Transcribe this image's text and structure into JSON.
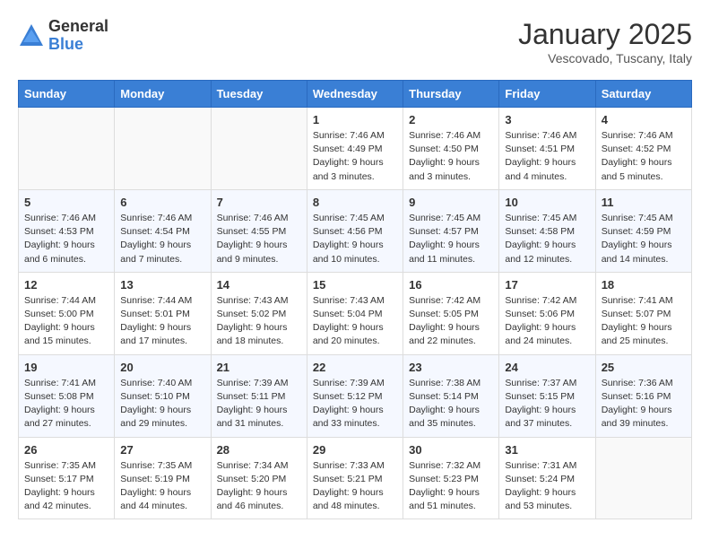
{
  "header": {
    "logo_general": "General",
    "logo_blue": "Blue",
    "title": "January 2025",
    "location": "Vescovado, Tuscany, Italy"
  },
  "weekdays": [
    "Sunday",
    "Monday",
    "Tuesday",
    "Wednesday",
    "Thursday",
    "Friday",
    "Saturday"
  ],
  "weeks": [
    [
      {
        "day": "",
        "info": ""
      },
      {
        "day": "",
        "info": ""
      },
      {
        "day": "",
        "info": ""
      },
      {
        "day": "1",
        "info": "Sunrise: 7:46 AM\nSunset: 4:49 PM\nDaylight: 9 hours and 3 minutes."
      },
      {
        "day": "2",
        "info": "Sunrise: 7:46 AM\nSunset: 4:50 PM\nDaylight: 9 hours and 3 minutes."
      },
      {
        "day": "3",
        "info": "Sunrise: 7:46 AM\nSunset: 4:51 PM\nDaylight: 9 hours and 4 minutes."
      },
      {
        "day": "4",
        "info": "Sunrise: 7:46 AM\nSunset: 4:52 PM\nDaylight: 9 hours and 5 minutes."
      }
    ],
    [
      {
        "day": "5",
        "info": "Sunrise: 7:46 AM\nSunset: 4:53 PM\nDaylight: 9 hours and 6 minutes."
      },
      {
        "day": "6",
        "info": "Sunrise: 7:46 AM\nSunset: 4:54 PM\nDaylight: 9 hours and 7 minutes."
      },
      {
        "day": "7",
        "info": "Sunrise: 7:46 AM\nSunset: 4:55 PM\nDaylight: 9 hours and 9 minutes."
      },
      {
        "day": "8",
        "info": "Sunrise: 7:45 AM\nSunset: 4:56 PM\nDaylight: 9 hours and 10 minutes."
      },
      {
        "day": "9",
        "info": "Sunrise: 7:45 AM\nSunset: 4:57 PM\nDaylight: 9 hours and 11 minutes."
      },
      {
        "day": "10",
        "info": "Sunrise: 7:45 AM\nSunset: 4:58 PM\nDaylight: 9 hours and 12 minutes."
      },
      {
        "day": "11",
        "info": "Sunrise: 7:45 AM\nSunset: 4:59 PM\nDaylight: 9 hours and 14 minutes."
      }
    ],
    [
      {
        "day": "12",
        "info": "Sunrise: 7:44 AM\nSunset: 5:00 PM\nDaylight: 9 hours and 15 minutes."
      },
      {
        "day": "13",
        "info": "Sunrise: 7:44 AM\nSunset: 5:01 PM\nDaylight: 9 hours and 17 minutes."
      },
      {
        "day": "14",
        "info": "Sunrise: 7:43 AM\nSunset: 5:02 PM\nDaylight: 9 hours and 18 minutes."
      },
      {
        "day": "15",
        "info": "Sunrise: 7:43 AM\nSunset: 5:04 PM\nDaylight: 9 hours and 20 minutes."
      },
      {
        "day": "16",
        "info": "Sunrise: 7:42 AM\nSunset: 5:05 PM\nDaylight: 9 hours and 22 minutes."
      },
      {
        "day": "17",
        "info": "Sunrise: 7:42 AM\nSunset: 5:06 PM\nDaylight: 9 hours and 24 minutes."
      },
      {
        "day": "18",
        "info": "Sunrise: 7:41 AM\nSunset: 5:07 PM\nDaylight: 9 hours and 25 minutes."
      }
    ],
    [
      {
        "day": "19",
        "info": "Sunrise: 7:41 AM\nSunset: 5:08 PM\nDaylight: 9 hours and 27 minutes."
      },
      {
        "day": "20",
        "info": "Sunrise: 7:40 AM\nSunset: 5:10 PM\nDaylight: 9 hours and 29 minutes."
      },
      {
        "day": "21",
        "info": "Sunrise: 7:39 AM\nSunset: 5:11 PM\nDaylight: 9 hours and 31 minutes."
      },
      {
        "day": "22",
        "info": "Sunrise: 7:39 AM\nSunset: 5:12 PM\nDaylight: 9 hours and 33 minutes."
      },
      {
        "day": "23",
        "info": "Sunrise: 7:38 AM\nSunset: 5:14 PM\nDaylight: 9 hours and 35 minutes."
      },
      {
        "day": "24",
        "info": "Sunrise: 7:37 AM\nSunset: 5:15 PM\nDaylight: 9 hours and 37 minutes."
      },
      {
        "day": "25",
        "info": "Sunrise: 7:36 AM\nSunset: 5:16 PM\nDaylight: 9 hours and 39 minutes."
      }
    ],
    [
      {
        "day": "26",
        "info": "Sunrise: 7:35 AM\nSunset: 5:17 PM\nDaylight: 9 hours and 42 minutes."
      },
      {
        "day": "27",
        "info": "Sunrise: 7:35 AM\nSunset: 5:19 PM\nDaylight: 9 hours and 44 minutes."
      },
      {
        "day": "28",
        "info": "Sunrise: 7:34 AM\nSunset: 5:20 PM\nDaylight: 9 hours and 46 minutes."
      },
      {
        "day": "29",
        "info": "Sunrise: 7:33 AM\nSunset: 5:21 PM\nDaylight: 9 hours and 48 minutes."
      },
      {
        "day": "30",
        "info": "Sunrise: 7:32 AM\nSunset: 5:23 PM\nDaylight: 9 hours and 51 minutes."
      },
      {
        "day": "31",
        "info": "Sunrise: 7:31 AM\nSunset: 5:24 PM\nDaylight: 9 hours and 53 minutes."
      },
      {
        "day": "",
        "info": ""
      }
    ]
  ]
}
